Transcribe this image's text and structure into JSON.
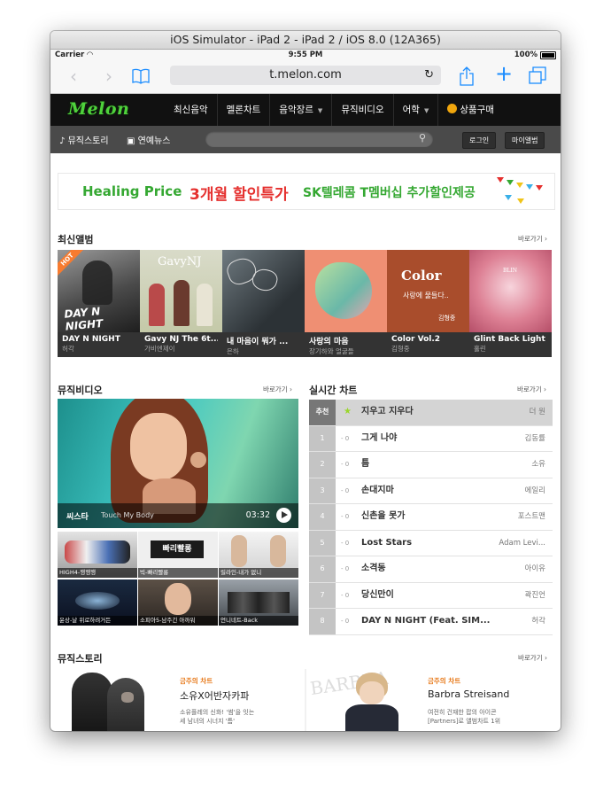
{
  "window_title": "iOS Simulator - iPad 2 - iPad 2 / iOS 8.0 (12A365)",
  "status": {
    "carrier": "Carrier",
    "time": "9:55 PM",
    "battery": "100%"
  },
  "browser": {
    "url": "t.melon.com"
  },
  "site": {
    "logo": "Melon",
    "menu": [
      "최신음악",
      "멜론차트",
      "음악장르",
      "뮤직비디오",
      "어학",
      "상품구매"
    ],
    "subnav": {
      "music_story": "뮤직스토리",
      "ent_news": "연예뉴스",
      "login": "로그인",
      "my_album": "마이앨범"
    }
  },
  "banner": {
    "part1": "Healing Price",
    "part2": "3개월 할인특가",
    "part3": "SK텔레콤 T멤버십 추가할인제공"
  },
  "new_albums": {
    "title": "최신앨범",
    "more": "바로가기",
    "hot_badge": "HOT",
    "items": [
      {
        "title": "DAY N NIGHT",
        "artist": "허각"
      },
      {
        "title": "Gavy NJ The 6t...",
        "artist": "가비엔제이"
      },
      {
        "title": "내 마음이 뭐가 ...",
        "artist": "은하"
      },
      {
        "title": "사랑의 마음",
        "artist": "장기하와 얼굴들"
      },
      {
        "title": "Color Vol.2",
        "artist": "김형중"
      },
      {
        "title": "Glint Back Light",
        "artist": "홀린"
      }
    ],
    "cover_text": {
      "dnn": "DAY N NIGHT",
      "gavy": "GavyNJ",
      "color": "Color",
      "color_sub": "사랑에 물들다..",
      "color_artist": "김형중",
      "glint": "BLIN"
    }
  },
  "music_video": {
    "title": "뮤직비디오",
    "more": "바로가기",
    "featured": {
      "artist": "씨스타",
      "song": "Touch My Body",
      "duration": "03:32"
    },
    "thumbs": [
      {
        "label": "HIGH4-행행행"
      },
      {
        "label": "빅-빠리빨롱"
      },
      {
        "label": "릴라인-내가 없니"
      },
      {
        "label": "윤상-날 위로하려거든"
      },
      {
        "label": "소피아5-남주긴 아까워"
      },
      {
        "label": "언니네트-Back"
      }
    ],
    "thumb_text": {
      "brand": "빠리빨롱"
    }
  },
  "realtime_chart": {
    "title": "실시간 차트",
    "more": "바로가기",
    "recommend_label": "추천",
    "change_label": "- 0",
    "rows": [
      {
        "rank": "추천",
        "title": "지우고 지우다",
        "artist": "더 원"
      },
      {
        "rank": "1",
        "title": "그게 나야",
        "artist": "김동률"
      },
      {
        "rank": "2",
        "title": "틈",
        "artist": "소유"
      },
      {
        "rank": "3",
        "title": "손대지마",
        "artist": "에일리"
      },
      {
        "rank": "4",
        "title": "신촌을 못가",
        "artist": "포스트맨"
      },
      {
        "rank": "5",
        "title": "Lost Stars",
        "artist": "Adam Levi..."
      },
      {
        "rank": "6",
        "title": "소격동",
        "artist": "아이유"
      },
      {
        "rank": "7",
        "title": "당신만이",
        "artist": "곽진언"
      },
      {
        "rank": "8",
        "title": "DAY N NIGHT (Feat. SIM...",
        "artist": "허각"
      }
    ]
  },
  "music_story": {
    "title": "뮤직스토리",
    "more": "바로가기",
    "items": [
      {
        "tag": "금주의 차트",
        "headline": "소유X어반자카파",
        "desc1": "소유플레의 신화! '썸'을 잇는",
        "desc2": "세 남녀의 시너지 '틈'"
      },
      {
        "tag": "금주의 차트",
        "headline": "Barbra Streisand",
        "desc1": "여전히 건재한 팝의 아이콘",
        "desc2": "[Partners]로 앨범차트 1위"
      }
    ],
    "photo_text": "BARBRA"
  },
  "colors": {
    "melon_green": "#4fd23c",
    "nav_bg": "#111111",
    "subnav_bg": "#4a4a4a",
    "ios_blue": "#1a8cff",
    "banner_red": "#e5302e",
    "banner_green": "#35a832"
  }
}
